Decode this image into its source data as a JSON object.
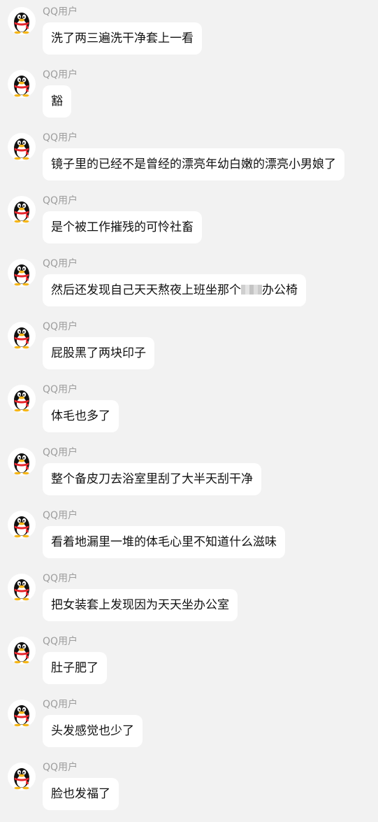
{
  "sender_name": "QQ用户",
  "avatar_icon": "qq-penguin-icon",
  "colors": {
    "background": "#f2f2f2",
    "bubble": "#ffffff",
    "sender_text": "#9d9d9d",
    "message_text": "#111111",
    "penguin_scarf": "#e8262d",
    "penguin_beak": "#f6b617"
  },
  "messages": [
    {
      "parts": [
        "洗了两三遍洗干净套上一看"
      ]
    },
    {
      "parts": [
        "豁"
      ]
    },
    {
      "parts": [
        "镜子里的已经不是曾经的漂亮年幼白嫩的漂亮小男娘了"
      ]
    },
    {
      "parts": [
        "是个被工作摧残的可怜社畜"
      ]
    },
    {
      "parts": [
        "然后还发现自己天天熬夜上班坐那个",
        "办公椅"
      ],
      "redacted": true
    },
    {
      "parts": [
        "屁股黑了两块印子"
      ]
    },
    {
      "parts": [
        "体毛也多了"
      ]
    },
    {
      "parts": [
        "整个备皮刀去浴室里刮了大半天刮干净"
      ]
    },
    {
      "parts": [
        "看着地漏里一堆的体毛心里不知道什么滋味"
      ]
    },
    {
      "parts": [
        "把女装套上发现因为天天坐办公室"
      ]
    },
    {
      "parts": [
        "肚子肥了"
      ]
    },
    {
      "parts": [
        "头发感觉也少了"
      ]
    },
    {
      "parts": [
        "脸也发福了"
      ]
    }
  ]
}
